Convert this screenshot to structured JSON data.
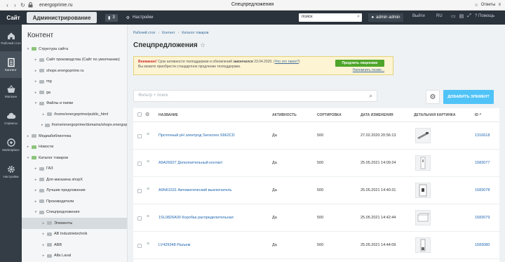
{
  "browser": {
    "url": "energoprime.ru",
    "title": "Спецпредложения",
    "right_label": "Ответы",
    "back": "‹",
    "forward": "›",
    "reload": "↻"
  },
  "admin_bar": {
    "site_tab": "Сайт",
    "admin_tab": "Администрирование",
    "badge_count": "3",
    "settings": "Настройки",
    "search_value": "поиск",
    "user": "admin admin",
    "logout": "Выйти",
    "lang": "RU",
    "help": "Помощь"
  },
  "left_nav": [
    {
      "label": "Рабочий стол",
      "icon": "home-icon"
    },
    {
      "label": "Контент",
      "icon": "document-icon",
      "active": true
    },
    {
      "label": "Магазин",
      "icon": "basket-icon"
    },
    {
      "label": "Сервисы",
      "icon": "cloud-icon"
    },
    {
      "label": "Marketplace",
      "icon": "marketplace-icon"
    },
    {
      "label": "Настройки",
      "icon": "gear-icon"
    }
  ],
  "tree": {
    "title": "Контент",
    "items": [
      {
        "label": "Структура сайта",
        "level": 0,
        "expanded": true,
        "green": true
      },
      {
        "label": "Сайт производства (Сайт по умолчанию)",
        "level": 1
      },
      {
        "label": "shopx.energoprime.ru",
        "level": 1
      },
      {
        "label": "mg",
        "level": 1
      },
      {
        "label": "ga",
        "level": 1
      },
      {
        "label": "Файлы и папки",
        "level": 1,
        "expanded": true
      },
      {
        "label": "/home/energoprime/public_html",
        "level": 2
      },
      {
        "label": "/home/energoprime/domains/shopx.energoprime.ru",
        "level": 2
      },
      {
        "label": "Медиабиблиотека",
        "level": 0
      },
      {
        "label": "Новости",
        "level": 0,
        "green": true
      },
      {
        "label": "Каталог товаров",
        "level": 0,
        "expanded": true,
        "green": true
      },
      {
        "label": "ГАЗ",
        "level": 1
      },
      {
        "label": "Для магазина shopX",
        "level": 1
      },
      {
        "label": "Лучшие предложения",
        "level": 1
      },
      {
        "label": "Производители",
        "level": 1
      },
      {
        "label": "Спецпредложения",
        "level": 1,
        "expanded": true
      },
      {
        "label": "Элементы",
        "level": 2,
        "active": true
      },
      {
        "label": "AB Industrietechnik",
        "level": 2
      },
      {
        "label": "ABB",
        "level": 2
      },
      {
        "label": "Alfa Laval",
        "level": 2
      }
    ]
  },
  "breadcrumb": [
    "Рабочий стол",
    "Контент",
    "Каталог товаров"
  ],
  "page_title": "Спецпредложения",
  "warning": {
    "strong": "Внимание!",
    "text_before": "Срок активности техподдержки и обновлений",
    "ended": "закончился",
    "date": "23.04.2020.",
    "link": "Что это такое?",
    "line2": "Вы можете приобрести стандартное продление техподдержки.",
    "button": "Продлить лицензию",
    "button_link": "Напомнить позже..."
  },
  "filter_placeholder": "Фильтр + поиск",
  "add_button": "ДОБАВИТЬ ЭЛЕМЕНТ",
  "columns": {
    "name": "НАЗВАНИЕ",
    "active": "АКТИВНОСТЬ",
    "sort": "СОРТИРОВКА",
    "date": "ДАТА ИЗМЕНЕНИЯ",
    "picture": "ДЕТАЛЬНАЯ КАРТИНКА",
    "id": "ID ^"
  },
  "rows": [
    {
      "name": "Проточный pH электрод Sensorex S662CD",
      "active": "Да",
      "sort": "500",
      "date": "27.02.2020 20:56:13",
      "id": "1316618"
    },
    {
      "name": "A9A26927 Дополнительный контакт",
      "active": "Да",
      "sort": "500",
      "date": "25.05.2021 14:09:24",
      "id": "1583077"
    },
    {
      "name": "A9N61531 Автоматический выключатель",
      "active": "Да",
      "sort": "500",
      "date": "25.05.2021 14:40:31",
      "id": "1583078"
    },
    {
      "name": "1SL0826A00 Коробка распределительная",
      "active": "Да",
      "sort": "500",
      "date": "25.05.2021 14:42:44",
      "id": "1583079"
    },
    {
      "name": "LV429348 Разъем",
      "active": "Да",
      "sort": "500",
      "date": "25.05.2021 14:44:09",
      "id": "1583080"
    }
  ]
}
